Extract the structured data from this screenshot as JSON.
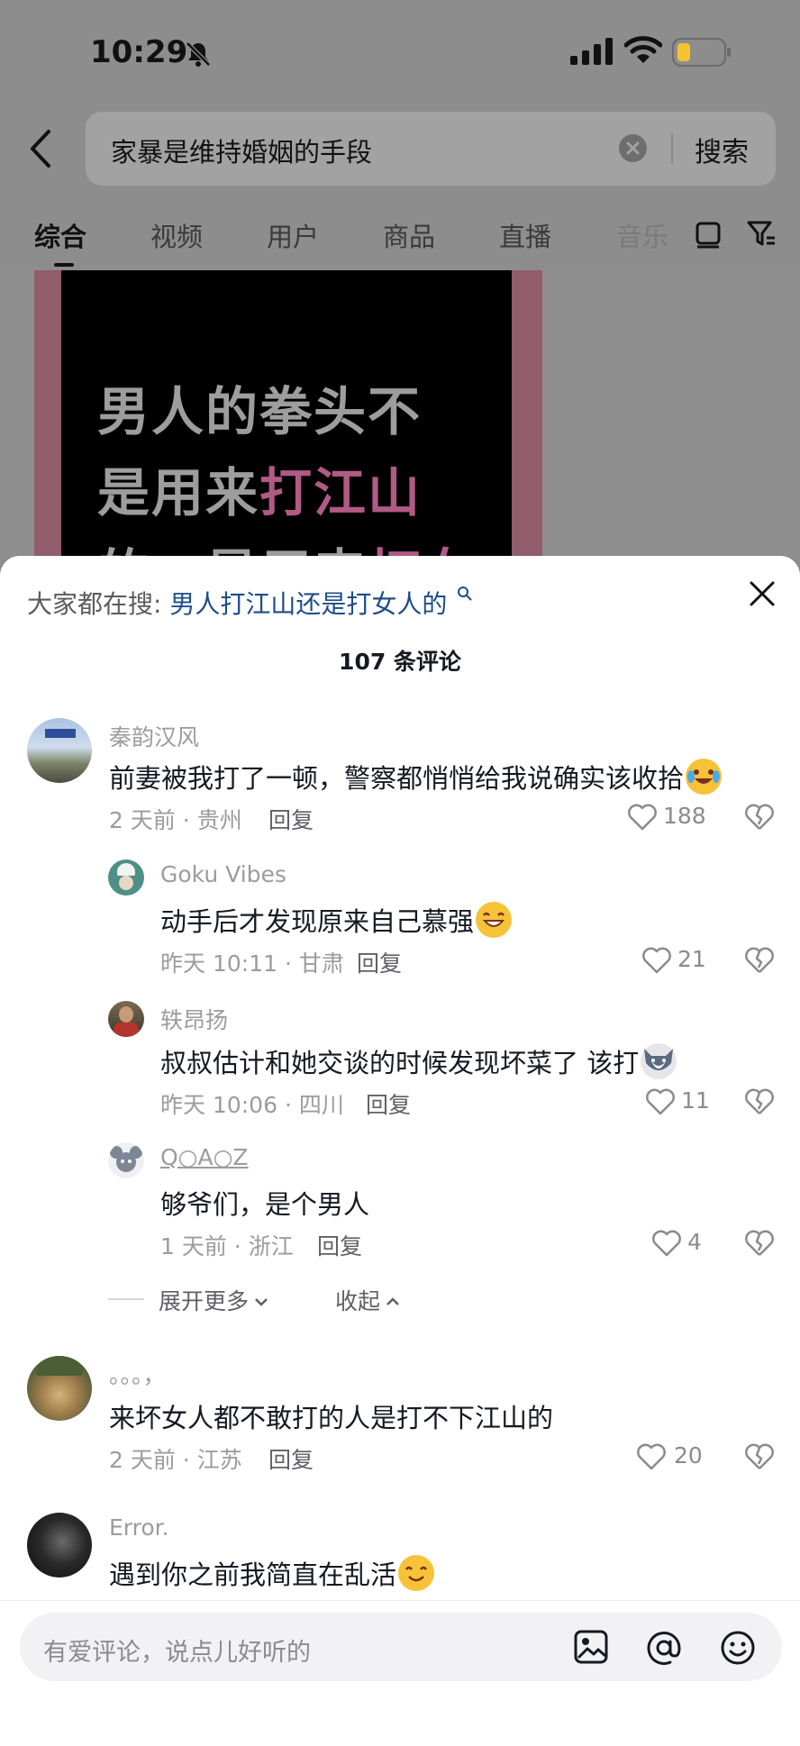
{
  "status_bar": {
    "time": "10:29"
  },
  "search": {
    "query": "家暴是维持婚姻的手段",
    "submit_label": "搜索"
  },
  "tabs": [
    "综合",
    "视频",
    "用户",
    "商品",
    "直播",
    "音乐"
  ],
  "video": {
    "line1": "男人的拳头不",
    "line2_a": "是用来",
    "line2_b": "打江山",
    "line3_a": "的，是用来",
    "line3_b": "打女"
  },
  "sheet": {
    "hot_search_prefix": "大家都在搜:",
    "hot_search_link": "男人打江山还是打女人的",
    "comment_count": "107 条评论"
  },
  "comments": [
    {
      "name": "秦韵汉风",
      "text": "前妻被我打了一顿，警察都悄悄给我说确实该收拾",
      "emoji": "laugh-cry-emoji",
      "meta": "2 天前 · 贵州",
      "reply": "回复",
      "likes": "188"
    },
    {
      "name": "Goku Vibes",
      "text": "动手后才发现原来自己慕强",
      "emoji": "grin-emoji",
      "meta": "昨天 10:11 · 甘肃",
      "reply": "回复",
      "likes": "21"
    },
    {
      "name": "轶昂扬",
      "text": "叔叔估计和她交谈的时候发现坏菜了 该打",
      "emoji": "husky-emoji",
      "meta": "昨天 10:06 · 四川",
      "reply": "回复",
      "likes": "11"
    },
    {
      "name": "Q○A○Z",
      "text": "够爷们，是个男人",
      "meta": "1 天前 · 浙江",
      "reply": "回复",
      "likes": "4"
    },
    {
      "name": "。。。，",
      "text": "来坏女人都不敢打的人是打不下江山的",
      "meta": "2 天前 · 江苏",
      "reply": "回复",
      "likes": "20"
    },
    {
      "name": "Error.",
      "text": "遇到你之前我简直在乱活",
      "emoji": "smile-emoji"
    }
  ],
  "expand": {
    "more_label": "展开更多",
    "collapse_label": "收起"
  },
  "input": {
    "placeholder": "有爱评论，说点儿好听的"
  },
  "colors": {
    "accent_link": "#1d4d8a",
    "video_pink": "#b05a86",
    "emoji_yellow": "#f6c338"
  }
}
